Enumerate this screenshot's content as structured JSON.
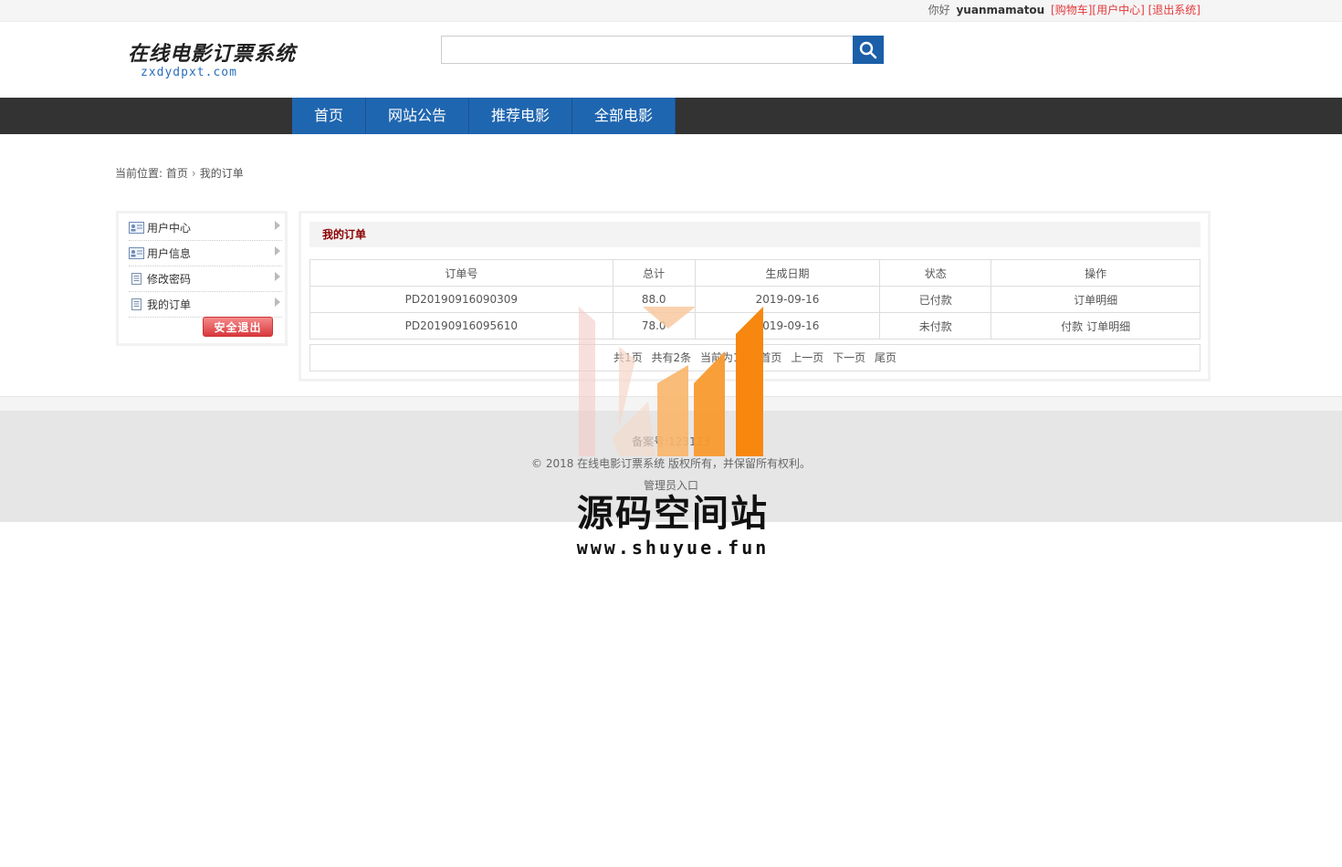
{
  "topbar": {
    "greeting": "你好",
    "username": "yuanmamatou",
    "links": [
      "[购物车]",
      "[用户中心]",
      "[退出系统]"
    ]
  },
  "logo": {
    "cn": "在线电影订票系统",
    "en": "zxdydpxt.com"
  },
  "search": {
    "placeholder": ""
  },
  "nav": {
    "items": [
      "首页",
      "网站公告",
      "推荐电影",
      "全部电影"
    ]
  },
  "breadcrumb": {
    "prefix": "当前位置:",
    "home": "首页",
    "current": "我的订单"
  },
  "sidebar": {
    "items": [
      "用户中心",
      "用户信息",
      "修改密码",
      "我的订单"
    ],
    "logout": "安全退出"
  },
  "orders": {
    "title": "我的订单",
    "headers": [
      "订单号",
      "总计",
      "生成日期",
      "状态",
      "操作"
    ],
    "rows": [
      {
        "id": "PD20190916090309",
        "total": "88.0",
        "date": "2019-09-16",
        "status": "已付款",
        "actions": [
          "订单明细"
        ]
      },
      {
        "id": "PD20190916095610",
        "total": "78.0",
        "date": "2019-09-16",
        "status": "未付款",
        "actions": [
          "付款",
          "订单明细"
        ]
      }
    ]
  },
  "pager": {
    "info": [
      "共1页",
      "共有2条",
      "当前为1页"
    ],
    "links": [
      "首页",
      "上一页",
      "下一页",
      "尾页"
    ]
  },
  "footer": {
    "icp": "备案号:123123",
    "copyright": "© 2018 在线电影订票系统 版权所有，并保留所有权利。",
    "admin": "管理员入口"
  },
  "watermark": {
    "title": "源码空间站",
    "url": "www.shuyue.fun"
  },
  "colors": {
    "nav_bg": "#333333",
    "nav_item": "#1f66b0",
    "accent_red": "#e4393c",
    "footer_bg": "#e6e6e6"
  }
}
